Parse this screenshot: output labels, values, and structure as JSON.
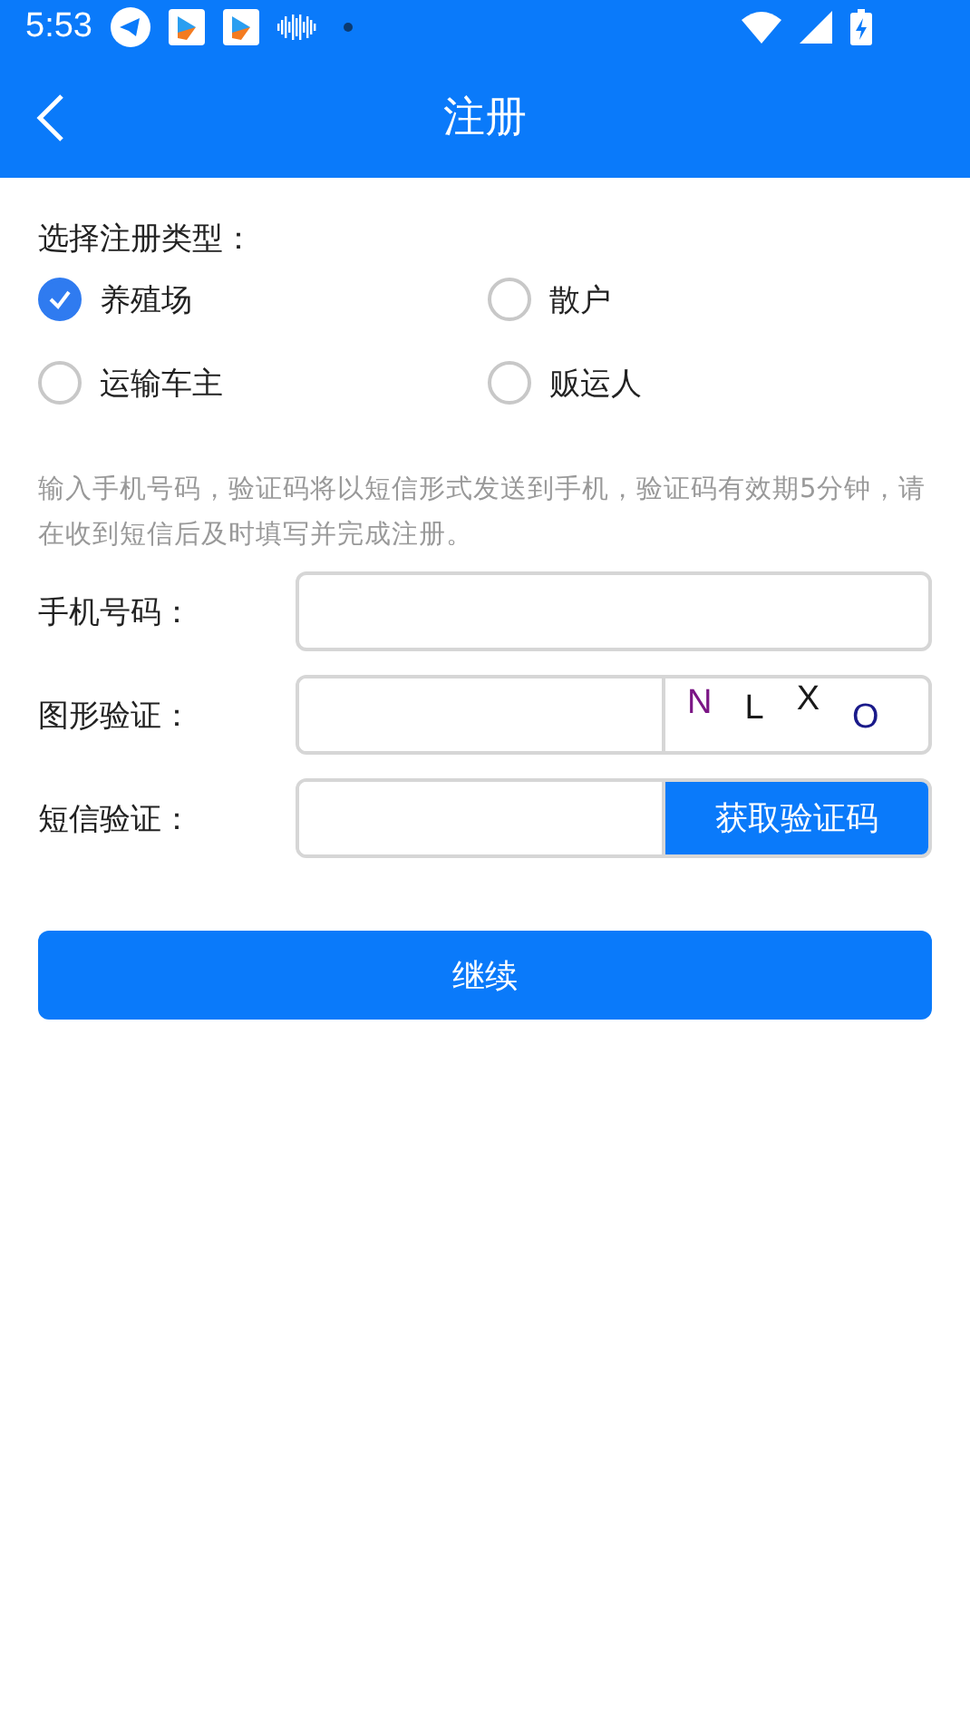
{
  "status_bar": {
    "time": "5:53"
  },
  "header": {
    "title": "注册"
  },
  "type_section": {
    "label": "选择注册类型：",
    "options": [
      {
        "label": "养殖场",
        "selected": true
      },
      {
        "label": "散户",
        "selected": false
      },
      {
        "label": "运输车主",
        "selected": false
      },
      {
        "label": "贩运人",
        "selected": false
      }
    ]
  },
  "hint": "输入手机号码，验证码将以短信形式发送到手机，验证码有效期5分钟，请在收到短信后及时填写并完成注册。",
  "fields": [
    {
      "kind": "plain",
      "label": "手机号码："
    },
    {
      "kind": "captcha",
      "label": "图形验证：",
      "captcha": [
        {
          "char": "N",
          "color": "#7b1685"
        },
        {
          "char": "L",
          "color": "#1a1a1a"
        },
        {
          "char": "X",
          "color": "#1a1a1a"
        },
        {
          "char": "O",
          "color": "#1a1a8a"
        }
      ]
    },
    {
      "kind": "sms",
      "label": "短信验证：",
      "button": "获取验证码"
    }
  ],
  "submit": "继续"
}
